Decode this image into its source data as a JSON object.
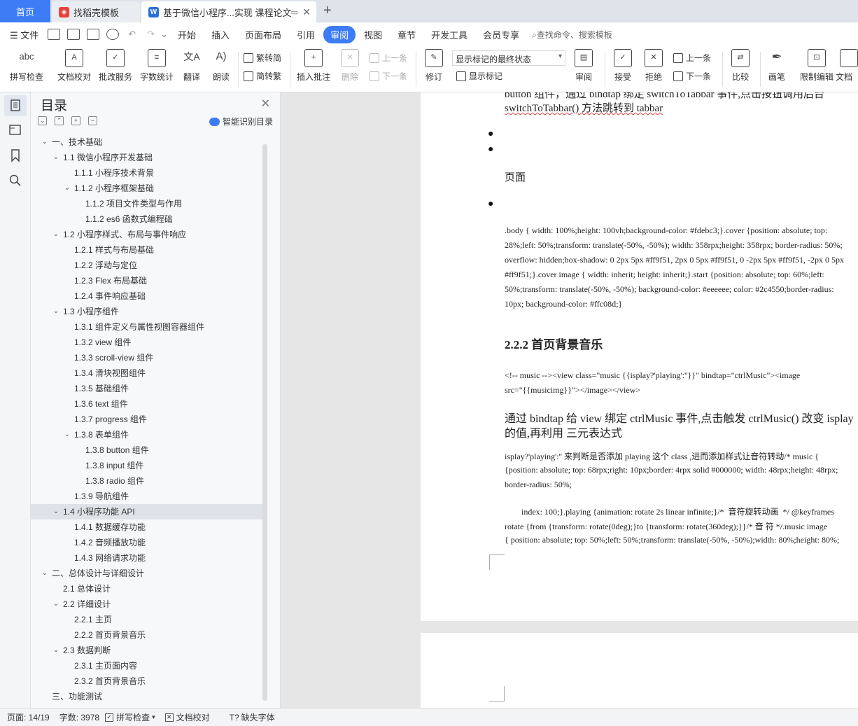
{
  "tabs": {
    "home": "首页",
    "templates": "找稻壳模板",
    "document": "基于微信小程序...实现 课程论文",
    "new_tab_symbol": "+"
  },
  "menu": {
    "file": "文件",
    "items": [
      "开始",
      "插入",
      "页面布局",
      "引用",
      "审阅",
      "视图",
      "章节",
      "开发工具",
      "会员专享"
    ],
    "active": "审阅",
    "search": "查找命令、搜索模板"
  },
  "toolbar": {
    "spell_check": "拼写检查",
    "doc_proof": "文档校对",
    "batch_review": "批改服务",
    "word_count": "字数统计",
    "translate": "翻译",
    "read_aloud": "朗读",
    "to_simplified": "繁转简",
    "to_traditional": "简转繁",
    "insert_comment": "插入批注",
    "delete": "删除",
    "prev": "上一条",
    "next": "下一条",
    "revise": "修订",
    "markup_state": "显示标记的最终状态",
    "show_markup": "显示标记",
    "review": "审阅",
    "accept": "接受",
    "reject": "拒绝",
    "prev_change": "上一条",
    "next_change": "下一条",
    "compare": "比较",
    "pen": "画笔",
    "restrict_edit": "限制编辑",
    "doc_partial": "文档"
  },
  "toc": {
    "title": "目录",
    "smart": "智能识别目录",
    "items": [
      {
        "text": "一、技术基础",
        "level": 1,
        "expanded": true
      },
      {
        "text": "1.1  微信小程序开发基础",
        "level": 2,
        "expanded": true
      },
      {
        "text": "1.1.1  小程序技术背景",
        "level": 3
      },
      {
        "text": "1.1.2  小程序框架基础",
        "level": 3,
        "expanded": true
      },
      {
        "text": "1.1.2  项目文件类型与作用",
        "level": 4
      },
      {
        "text": "1.1.2 es6  函数式编程础",
        "level": 4
      },
      {
        "text": "1.2  小程序样式、布局与事件响应",
        "level": 2,
        "expanded": true
      },
      {
        "text": "1.2.1  样式与布局基础",
        "level": 3
      },
      {
        "text": "1.2.2  浮动与定位",
        "level": 3
      },
      {
        "text": "1.2.3 Flex  布局基础",
        "level": 3
      },
      {
        "text": "1.2.4  事件响应基础",
        "level": 3
      },
      {
        "text": "1.3  小程序组件",
        "level": 2,
        "expanded": true
      },
      {
        "text": "1.3.1  组件定义与属性视图容器组件",
        "level": 3
      },
      {
        "text": "1.3.2 view  组件",
        "level": 3
      },
      {
        "text": "1.3.3 scroll-view  组件",
        "level": 3
      },
      {
        "text": "1.3.4  滑块视图组件",
        "level": 3
      },
      {
        "text": "1.3.5  基础组件",
        "level": 3
      },
      {
        "text": "1.3.6 text  组件",
        "level": 3
      },
      {
        "text": "1.3.7 progress  组件",
        "level": 3
      },
      {
        "text": "1.3.8  表单组件",
        "level": 3,
        "expanded": true
      },
      {
        "text": "1.3.8 button  组件",
        "level": 4
      },
      {
        "text": "1.3.8 input  组件",
        "level": 4
      },
      {
        "text": "1.3.8 radio  组件",
        "level": 4
      },
      {
        "text": "1.3.9  导航组件",
        "level": 3
      },
      {
        "text": "1.4  小程序功能  API",
        "level": 2,
        "expanded": true,
        "selected": true
      },
      {
        "text": "1.4.1  数据缓存功能",
        "level": 3
      },
      {
        "text": "1.4.2  音频播放功能",
        "level": 3
      },
      {
        "text": "1.4.3  网络请求功能",
        "level": 3
      },
      {
        "text": "二、总体设计与详细设计",
        "level": 1,
        "expanded": true
      },
      {
        "text": "2.1  总体设计",
        "level": 2
      },
      {
        "text": "2.2  详细设计",
        "level": 2,
        "expanded": true
      },
      {
        "text": "2.2.1  主页",
        "level": 3
      },
      {
        "text": "2.2.2  首页背景音乐",
        "level": 3
      },
      {
        "text": "2.3  数据判断",
        "level": 2,
        "expanded": true
      },
      {
        "text": "2.3.1  主页面内容",
        "level": 3
      },
      {
        "text": "2.3.2  首页背景音乐",
        "level": 3
      },
      {
        "text": "三、功能测试",
        "level": 1
      }
    ]
  },
  "document": {
    "line_top_partial": "button  组件，通过  bindtap  绑定  switchToTabbar  事件,点击按钮调用后台",
    "line_switch": "switchToTabbar()  方法跳转到  tabbar",
    "page_word": "页面",
    "css_lines": [
      ".body    { width: 100%;height: 100vh;background-color: #fdebc3;}.cover {position: absolute; top:",
      "28%;left: 50%;transform: translate(-50%, -50%); width: 358rpx;height: 358rpx; border-radius: 50%;",
      "overflow: hidden;box-shadow: 0 2px 5px #ff9f51, 2px 0 5px #ff9f51, 0 -2px 5px #ff9f51, -2px 0 5px",
      "#ff9f51;}.cover image { width: inherit; height: inherit;}.start {position: absolute; top: 60%;left:",
      "50%;transform: translate(-50%, -50%); background-color:    #eeeeee; color: #2c4550;border-radius:",
      "10px; background-color: #ffc08d;}"
    ],
    "heading": "2.2.2  首页背景音乐",
    "code_line1": "<!-- music --><view class=\"music {{isplay?'playing':''}}\" bindtap=\"ctrlMusic\"><image",
    "code_line2": "src=\"{{musicimg}}\"></image></view>",
    "para_line1": "通过  bindtap  给  view  绑定  ctrlMusic  事件,点击触发  ctrlMusic()  改变  isplay",
    "para_line2": "的值,再利用  三元表达式",
    "mix_line1": "isplay?'playing':''  来判断是否添加  playing  这个  class ,进而添加样式让音符转动/* music {",
    "mix_line2": "{position: absolute; top: 68rpx;right: 10px;border: 4rpx solid #000000; width: 48rpx;height: 48rpx;",
    "mix_line3": "border-radius: 50%;",
    "mix_line4": "        index: 100;}.playing {animation: rotate 2s linear infinite;}/*  音符旋转动画  */ @keyframes",
    "mix_line5": "rotate {from {transform: rotate(0deg);}to {transform: rotate(360deg);}}/*  音  符  */.music image",
    "mix_line6": "{ position: absolute; top: 50%;left: 50%;transform: translate(-50%, -50%);width: 80%;height: 80%;"
  },
  "status": {
    "page": "页面: 14/19",
    "words": "字数: 3978",
    "spell": "拼写检查",
    "proof": "文档校对",
    "missing_font": "缺失字体"
  },
  "colors": {
    "accent": "#3d7cf5",
    "wps_red": "#e8423b",
    "wps_blue": "#2b6fd6"
  }
}
